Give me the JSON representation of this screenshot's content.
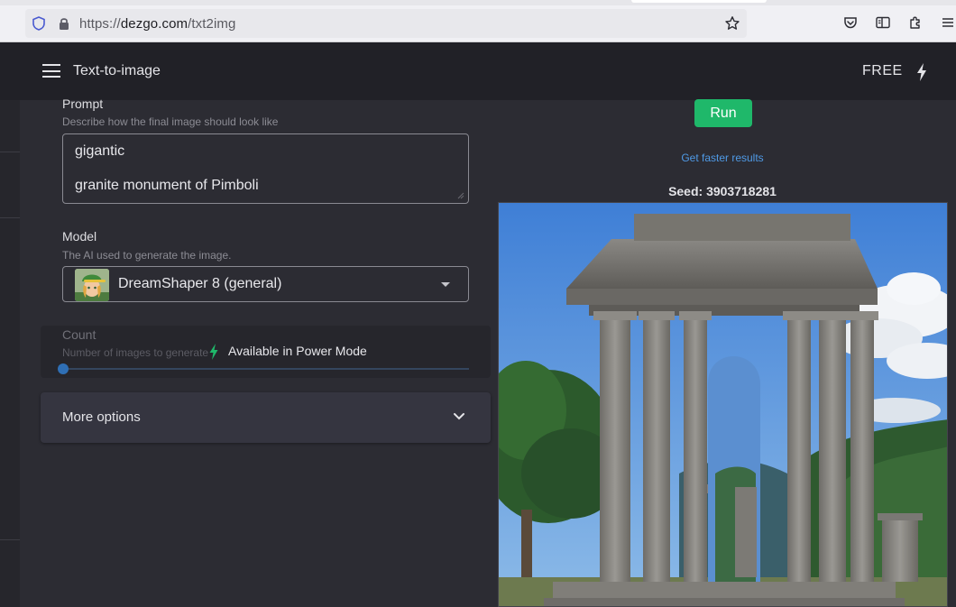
{
  "browser": {
    "url_scheme": "https://",
    "url_host": "dezgo.com",
    "url_path": "/txt2img",
    "icons": [
      "shield-icon",
      "lock-icon",
      "star-icon",
      "pocket-icon",
      "reader-view-icon",
      "extensions-icon",
      "menu-icon"
    ]
  },
  "header": {
    "title": "Text-to-image",
    "plan": "FREE",
    "icons": [
      "hamburger-icon",
      "bolt-icon"
    ]
  },
  "prompt": {
    "label": "Prompt",
    "help": "Describe how the final image should look like",
    "line1": "gigantic",
    "line2": "granite monument of Pimboli"
  },
  "model": {
    "label": "Model",
    "help": "The AI used to generate the image.",
    "selected": "DreamShaper 8 (general)"
  },
  "count": {
    "label": "Count",
    "help": "Number of images to generate",
    "value": 1,
    "overlay_text": "Available in Power Mode"
  },
  "more_options": {
    "label": "More options"
  },
  "result": {
    "run_label": "Run",
    "faster_link": "Get faster results",
    "seed_text": "Seed: 3903718281"
  },
  "colors": {
    "accent_green": "#1fb86a",
    "link_blue": "#4f9ae6",
    "background": "#2c2c33",
    "header": "#212127"
  }
}
